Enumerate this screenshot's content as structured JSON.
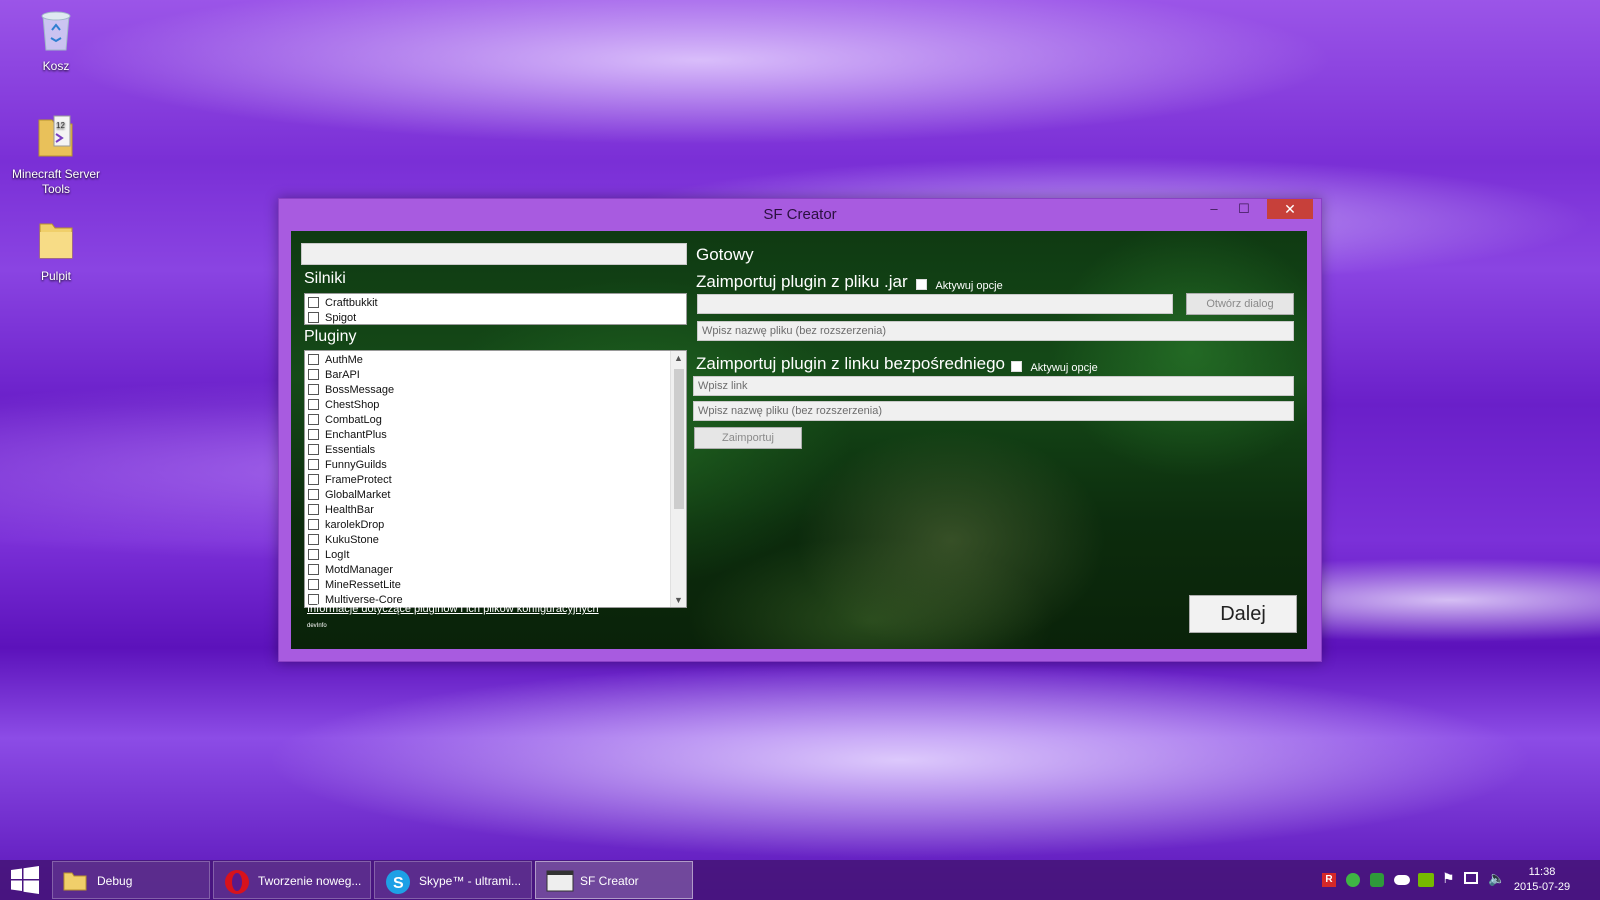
{
  "desktop": {
    "icons": [
      {
        "label": "Kosz",
        "icon": "recycle-bin-icon"
      },
      {
        "label_line1": "Minecraft Server",
        "label_line2": "Tools",
        "icon": "visual-studio-folder-icon"
      },
      {
        "label": "Pulpit",
        "icon": "folder-icon"
      }
    ]
  },
  "window": {
    "title": "SF Creator",
    "minimize": "–",
    "maximize": "☐",
    "close": "✕",
    "top_field": {
      "value": ""
    },
    "engines_label": "Silniki",
    "engines": [
      "Craftbukkit",
      "Spigot"
    ],
    "plugins_label": "Pluginy",
    "plugins": [
      "AuthMe",
      "BarAPI",
      "BossMessage",
      "ChestShop",
      "CombatLog",
      "EnchantPlus",
      "Essentials",
      "FunnyGuilds",
      "FrameProtect",
      "GlobalMarket",
      "HealthBar",
      "karolekDrop",
      "KukuStone",
      "LogIt",
      "MotdManager",
      "MineRessetLite",
      "Multiverse-Core"
    ],
    "info_link": "Informacje dotyczące pluginów i ich plików konfiguracyjnych",
    "dev_info": "devInfo",
    "status": "Gotowy",
    "import_jar_label": "Zaimportuj plugin z pliku .jar",
    "activate_options_label": "Aktywuj opcje",
    "open_dialog_button": "Otwórz dialog",
    "filename_placeholder": "Wpisz nazwę pliku (bez rozszerzenia)",
    "import_link_label": "Zaimportuj plugin z linku bezpośredniego",
    "link_placeholder": "Wpisz link",
    "import_button": "Zaimportuj",
    "next_button": "Dalej"
  },
  "taskbar": {
    "items": [
      {
        "label": "Debug",
        "icon": "folder-icon"
      },
      {
        "label": "Tworzenie noweg...",
        "icon": "opera-icon"
      },
      {
        "label": "Skype™ - ultrami...",
        "icon": "skype-icon"
      },
      {
        "label": "SF Creator",
        "icon": "app-window-icon",
        "active": true
      }
    ],
    "clock": {
      "time": "11:38",
      "date": "2015-07-29"
    },
    "colors": {
      "accent": "#a85be0",
      "close": "#c7403a"
    }
  }
}
